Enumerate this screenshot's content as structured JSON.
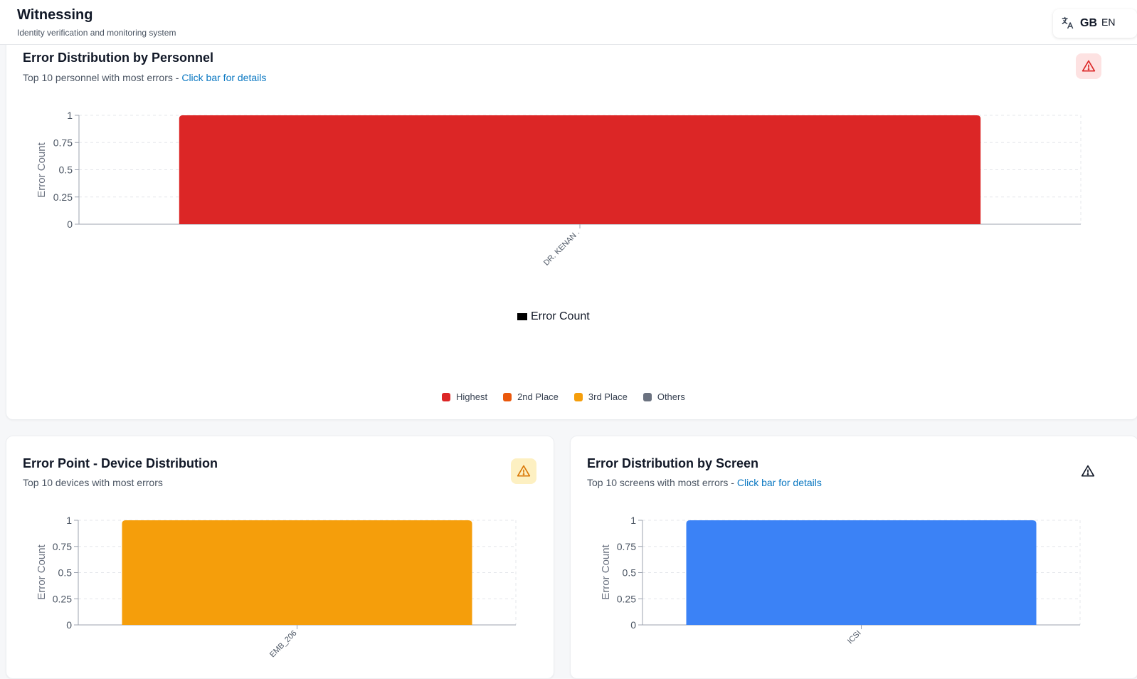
{
  "header": {
    "title": "Witnessing",
    "subtitle": "Identity verification and monitoring system",
    "language_icon": "translate-icon",
    "language_flag": "GB",
    "language_code": "EN"
  },
  "personnel_card": {
    "title": "Error Distribution by Personnel",
    "subtitle": "Top 10 personnel with most errors - ",
    "link": "Click bar for details",
    "icon": "warning-icon",
    "chart_legend": "Error Count",
    "rank_legend": [
      {
        "label": "Highest",
        "color": "#dc2626"
      },
      {
        "label": "2nd Place",
        "color": "#ea580c"
      },
      {
        "label": "3rd Place",
        "color": "#f59e0b"
      },
      {
        "label": "Others",
        "color": "#6b7280"
      }
    ]
  },
  "device_card": {
    "title": "Error Point - Device Distribution",
    "subtitle": "Top 10 devices with most errors",
    "icon": "warning-icon"
  },
  "screen_card": {
    "title": "Error Distribution by Screen",
    "subtitle": "Top 10 screens with most errors - ",
    "link": "Click bar for details",
    "icon": "warning-icon"
  },
  "chart_data": [
    {
      "type": "bar",
      "title": "Error Distribution by Personnel",
      "categories": [
        "DR. KENAN ."
      ],
      "values": [
        1
      ],
      "colors": [
        "#dc2626"
      ],
      "ylabel": "Error Count",
      "ylim": [
        0,
        1
      ],
      "yticks": [
        "0",
        "0.25",
        "0.5",
        "0.75",
        "1"
      ],
      "grid": true
    },
    {
      "type": "bar",
      "title": "Error Point - Device Distribution",
      "categories": [
        "EMB_206"
      ],
      "values": [
        1
      ],
      "colors": [
        "#f59e0b"
      ],
      "ylabel": "Error Count",
      "ylim": [
        0,
        1
      ],
      "yticks": [
        "0",
        "0.25",
        "0.5",
        "0.75",
        "1"
      ],
      "grid": true
    },
    {
      "type": "bar",
      "title": "Error Distribution by Screen",
      "categories": [
        "ICSI"
      ],
      "values": [
        1
      ],
      "colors": [
        "#3b82f6"
      ],
      "ylabel": "Error Count",
      "ylim": [
        0,
        1
      ],
      "yticks": [
        "0",
        "0.25",
        "0.5",
        "0.75",
        "1"
      ],
      "grid": true
    }
  ]
}
